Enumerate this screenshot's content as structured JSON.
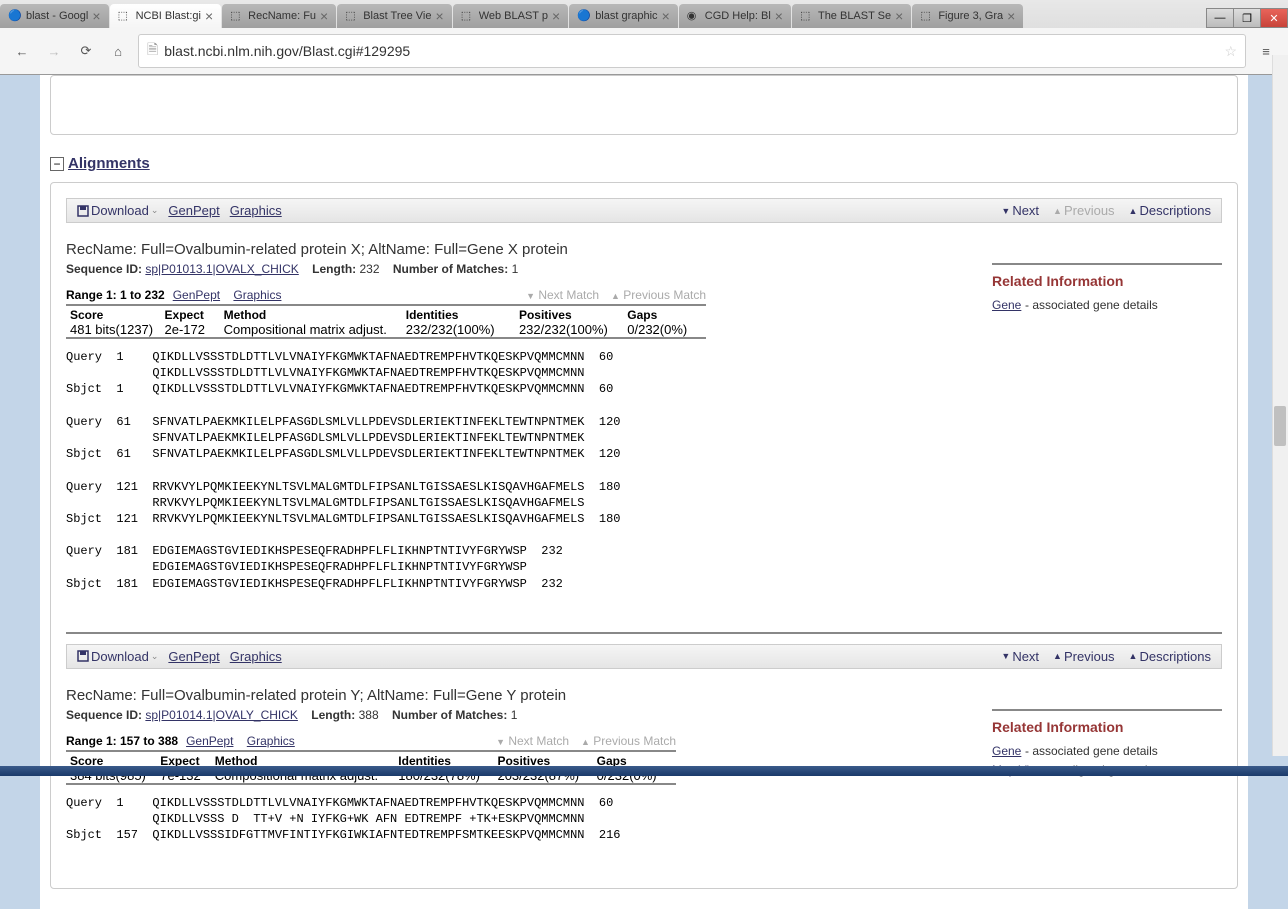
{
  "browser": {
    "tabs": [
      {
        "title": "blast - Googl",
        "icon": "google"
      },
      {
        "title": "NCBI Blast:gi",
        "icon": "ncbi",
        "active": true
      },
      {
        "title": "RecName: Fu",
        "icon": "ncbi"
      },
      {
        "title": "Blast Tree Vie",
        "icon": "ncbi"
      },
      {
        "title": "Web BLAST p",
        "icon": "ncbi"
      },
      {
        "title": "blast graphic",
        "icon": "google"
      },
      {
        "title": "CGD Help: Bl",
        "icon": "cgd"
      },
      {
        "title": "The BLAST Se",
        "icon": "ncbi"
      },
      {
        "title": "Figure 3, Gra",
        "icon": "ncbi"
      }
    ],
    "url": "blast.ncbi.nlm.nih.gov/Blast.cgi#129295"
  },
  "section_title": "Alignments",
  "toolbar": {
    "download": "Download",
    "genpept": "GenPept",
    "graphics": "Graphics",
    "next": "Next",
    "previous": "Previous",
    "descriptions": "Descriptions"
  },
  "alignments": [
    {
      "rec_name": "RecName: Full=Ovalbumin-related protein X; AltName: Full=Gene X protein",
      "seq_id_label": "Sequence ID:",
      "seq_id": "sp|P01013.1|OVALX_CHICK",
      "length_label": "Length:",
      "length": "232",
      "matches_label": "Number of Matches:",
      "matches": "1",
      "range_label": "Range 1: 1 to 232",
      "genpept": "GenPept",
      "graphics": "Graphics",
      "next_match": "Next Match",
      "prev_match": "Previous Match",
      "headers": {
        "score": "Score",
        "expect": "Expect",
        "method": "Method",
        "identities": "Identities",
        "positives": "Positives",
        "gaps": "Gaps"
      },
      "stats": {
        "score": "481 bits(1237)",
        "expect": "2e-172",
        "method": "Compositional matrix adjust.",
        "identities": "232/232(100%)",
        "positives": "232/232(100%)",
        "gaps": "0/232(0%)"
      },
      "alignment_lines": "Query  1    QIKDLLVSSSTDLDTTLVLVNAIYFKGMWKTAFNAEDTREMPFHVTKQESKPVQMMCMNN  60\n            QIKDLLVSSSTDLDTTLVLVNAIYFKGMWKTAFNAEDTREMPFHVTKQESKPVQMMCMNN\nSbjct  1    QIKDLLVSSSTDLDTTLVLVNAIYFKGMWKTAFNAEDTREMPFHVTKQESKPVQMMCMNN  60\n\nQuery  61   SFNVATLPAEKMKILELPFASGDLSMLVLLPDEVSDLERIEKTINFEKLTEWTNPNTMEK  120\n            SFNVATLPAEKMKILELPFASGDLSMLVLLPDEVSDLERIEKTINFEKLTEWTNPNTMEK\nSbjct  61   SFNVATLPAEKMKILELPFASGDLSMLVLLPDEVSDLERIEKTINFEKLTEWTNPNTMEK  120\n\nQuery  121  RRVKVYLPQMKIEEKYNLTSVLMALGMTDLFIPSANLTGISSAESLKISQAVHGAFMELS  180\n            RRVKVYLPQMKIEEKYNLTSVLMALGMTDLFIPSANLTGISSAESLKISQAVHGAFMELS\nSbjct  121  RRVKVYLPQMKIEEKYNLTSVLMALGMTDLFIPSANLTGISSAESLKISQAVHGAFMELS  180\n\nQuery  181  EDGIEMAGSTGVIEDIKHSPESEQFRADHPFLFLIKHNPTNTIVYFGRYWSP  232\n            EDGIEMAGSTGVIEDIKHSPESEQFRADHPFLFLIKHNPTNTIVYFGRYWSP\nSbjct  181  EDGIEMAGSTGVIEDIKHSPESEQFRADHPFLFLIKHNPTNTIVYFGRYWSP  232",
      "related_header": "Related Information",
      "related": [
        {
          "link": "Gene",
          "text": "- associated gene details"
        }
      ]
    },
    {
      "rec_name": "RecName: Full=Ovalbumin-related protein Y; AltName: Full=Gene Y protein",
      "seq_id_label": "Sequence ID:",
      "seq_id": "sp|P01014.1|OVALY_CHICK",
      "length_label": "Length:",
      "length": "388",
      "matches_label": "Number of Matches:",
      "matches": "1",
      "range_label": "Range 1: 157 to 388",
      "genpept": "GenPept",
      "graphics": "Graphics",
      "next_match": "Next Match",
      "prev_match": "Previous Match",
      "headers": {
        "score": "Score",
        "expect": "Expect",
        "method": "Method",
        "identities": "Identities",
        "positives": "Positives",
        "gaps": "Gaps"
      },
      "stats": {
        "score": "384 bits(985)",
        "expect": "7e-132",
        "method": "Compositional matrix adjust.",
        "identities": "180/232(78%)",
        "positives": "203/232(87%)",
        "gaps": "0/232(0%)"
      },
      "alignment_lines": "Query  1    QIKDLLVSSSTDLDTTLVLVNAIYFKGMWKTAFNAEDTREMPFHVTKQESKPVQMMCMNN  60\n            QIKDLLVSSS D  TT+V +N IYFKG+WK AFN EDTREMPF +TK+ESKPVQMMCMNN\nSbjct  157  QIKDLLVSSSIDFGTTMVFINTIYFKGIWKIAFNTEDTREMPFSMTKEESKPVQMMCMNN  216",
      "related_header": "Related Information",
      "related": [
        {
          "link": "Gene",
          "text": "- associated gene details"
        },
        {
          "link": "Map Viewer",
          "text": "- aligned genomic context"
        }
      ]
    }
  ]
}
